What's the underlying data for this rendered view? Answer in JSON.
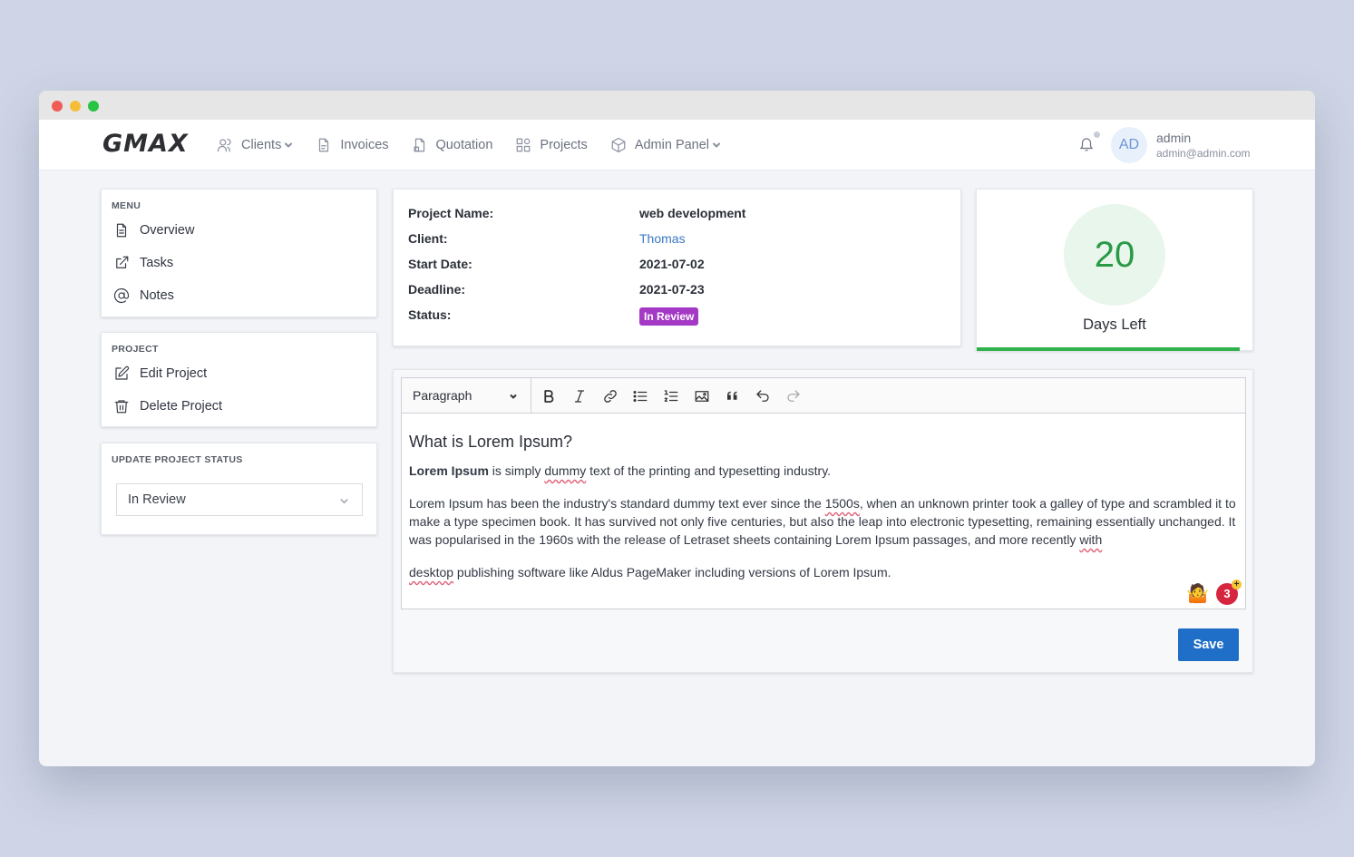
{
  "navbar": {
    "logo": "GMAX",
    "items": [
      {
        "label": "Clients",
        "icon": "users-icon",
        "dropdown": true
      },
      {
        "label": "Invoices",
        "icon": "file-icon",
        "dropdown": false
      },
      {
        "label": "Quotation",
        "icon": "file-quote-icon",
        "dropdown": false
      },
      {
        "label": "Projects",
        "icon": "grid-icon",
        "dropdown": false
      },
      {
        "label": "Admin Panel",
        "icon": "box-icon",
        "dropdown": true
      }
    ],
    "user": {
      "initials": "AD",
      "name": "admin",
      "email": "admin@admin.com"
    }
  },
  "sidebar": {
    "menu": {
      "title": "MENU",
      "items": [
        {
          "label": "Overview",
          "icon": "file-text-icon"
        },
        {
          "label": "Tasks",
          "icon": "external-link-icon"
        },
        {
          "label": "Notes",
          "icon": "at-sign-icon"
        }
      ]
    },
    "project": {
      "title": "PROJECT",
      "items": [
        {
          "label": "Edit Project",
          "icon": "edit-icon"
        },
        {
          "label": "Delete Project",
          "icon": "trash-icon"
        }
      ]
    },
    "status": {
      "title": "UPDATE PROJECT STATUS",
      "selected": "In Review"
    }
  },
  "project_info": {
    "name_label": "Project Name:",
    "name": "web development",
    "client_label": "Client:",
    "client": "Thomas",
    "start_label": "Start Date:",
    "start": "2021-07-02",
    "deadline_label": "Deadline:",
    "deadline": "2021-07-23",
    "status_label": "Status:",
    "status": "In Review",
    "status_color": "#a339c4"
  },
  "days_left": {
    "value": "20",
    "label": "Days Left",
    "accent": "#2fb14b"
  },
  "editor": {
    "block_type": "Paragraph",
    "heading": "What is Lorem Ipsum?",
    "p1_bold": "Lorem Ipsum",
    "p1_a": " is simply ",
    "p1_sp": "dummy",
    "p1_b": " text of the printing and typesetting industry.",
    "p2_a": "Lorem Ipsum has been the industry's standard dummy text ever since the ",
    "p2_sp1": "1500s",
    "p2_b": ", when an unknown printer took a galley of type and scrambled it to make a type specimen book. It has survived not only five centuries, but also the leap into electronic typesetting, remaining essentially unchanged. It was popularised in the 1960s with the release of Letraset sheets containing Lorem Ipsum passages, and more recently ",
    "p2_sp2": "with",
    "p3_sp": "desktop",
    "p3_b": " publishing software like Aldus PageMaker including versions of Lorem Ipsum.",
    "collaborators_count": "3",
    "collab_emoji": "🤷",
    "save_label": "Save"
  }
}
